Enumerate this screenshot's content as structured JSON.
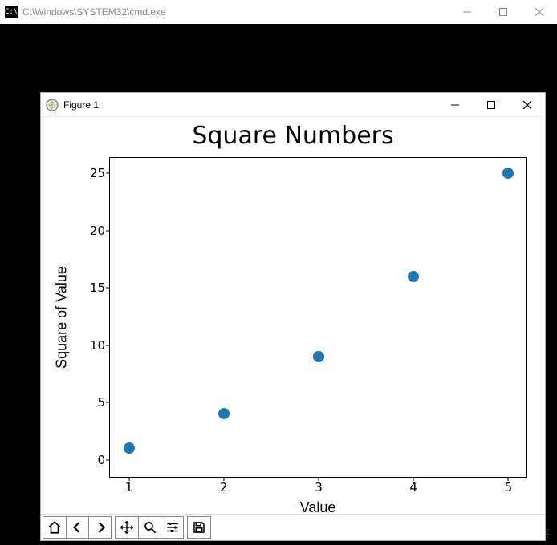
{
  "cmd": {
    "title": "C:\\Windows\\SYSTEM32\\cmd.exe",
    "icon_text": "C:\\"
  },
  "figure": {
    "title": "Figure 1"
  },
  "chart_data": {
    "type": "scatter",
    "title": "Square Numbers",
    "xlabel": "Value",
    "ylabel": "Square of Value",
    "x": [
      1,
      2,
      3,
      4,
      5
    ],
    "y": [
      1,
      4,
      9,
      16,
      25
    ],
    "xticks": [
      1,
      2,
      3,
      4,
      5
    ],
    "yticks": [
      0,
      5,
      10,
      15,
      20,
      25
    ],
    "xlim": [
      0.8,
      5.2
    ],
    "ylim": [
      -1.5,
      26.5
    ],
    "marker_color": "#1f77b4"
  },
  "toolbar": {
    "home": "home-icon",
    "back": "arrow-left-icon",
    "forward": "arrow-right-icon",
    "pan": "move-icon",
    "zoom": "zoom-icon",
    "configure": "sliders-icon",
    "save": "save-icon"
  },
  "watermark": "©51CTO博客"
}
